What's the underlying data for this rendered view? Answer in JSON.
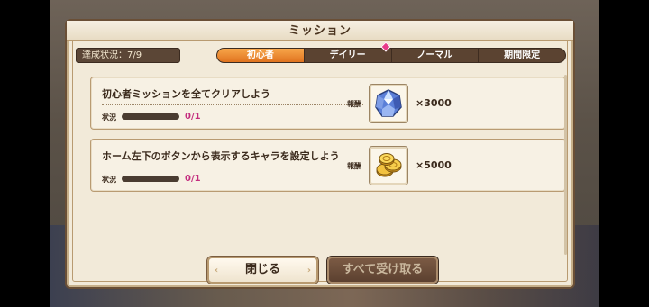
{
  "dialog": {
    "title": "ミッション",
    "achievement_label": "達成状況：7/9"
  },
  "tabs": [
    {
      "label": "初心者",
      "active": true
    },
    {
      "label": "デイリー",
      "active": false,
      "has_notification": true
    },
    {
      "label": "ノーマル",
      "active": false
    },
    {
      "label": "期間限定",
      "active": false
    }
  ],
  "missions": [
    {
      "title": "初心者ミッションを全てクリアしよう",
      "status_label": "状況",
      "progress": "0/1",
      "progress_fraction": 0,
      "reward_label": "報酬",
      "reward_icon": "crystal-gem-icon",
      "reward_qty": "×3000"
    },
    {
      "title": "ホーム左下のボタンから表示するキャラを設定しよう",
      "status_label": "状況",
      "progress": "0/1",
      "progress_fraction": 0,
      "reward_label": "報酬",
      "reward_icon": "gold-coins-icon",
      "reward_qty": "×5000"
    }
  ],
  "buttons": {
    "close_label": "閉じる",
    "receive_all_label": "すべて受け取る"
  },
  "colors": {
    "active_tab": "#e0731f",
    "progress_text": "#c42d7e",
    "notification": "#e8398a"
  }
}
